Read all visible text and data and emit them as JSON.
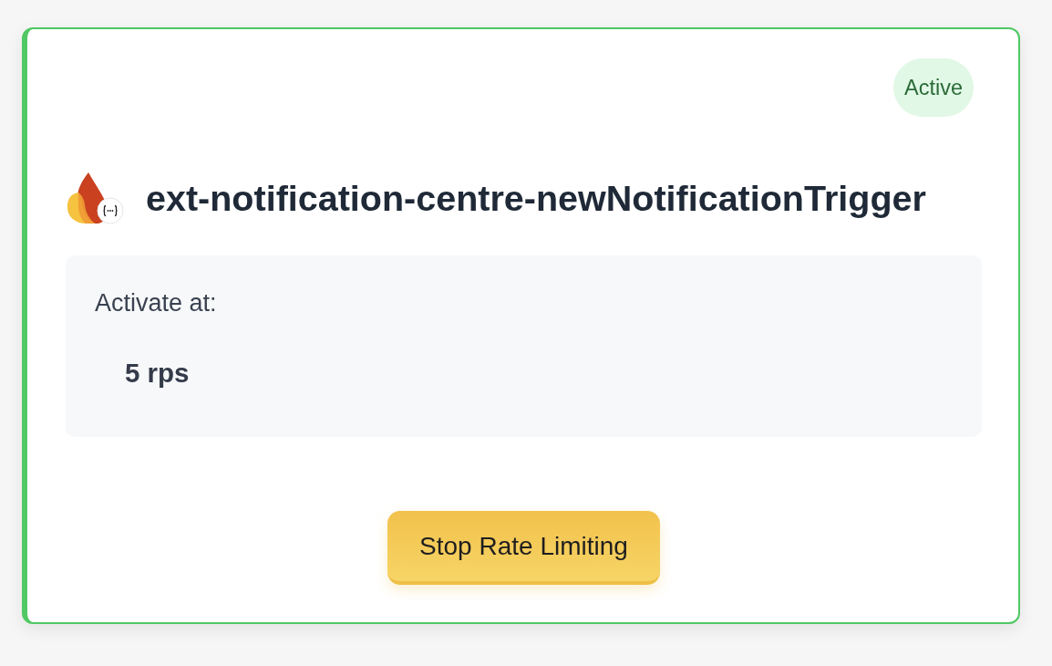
{
  "status": {
    "label": "Active",
    "kind": "active"
  },
  "function": {
    "name": "ext-notification-centre-newNotificationTrigger"
  },
  "threshold": {
    "label": "Activate at:",
    "value": "5 rps"
  },
  "action": {
    "label": "Stop Rate Limiting"
  }
}
